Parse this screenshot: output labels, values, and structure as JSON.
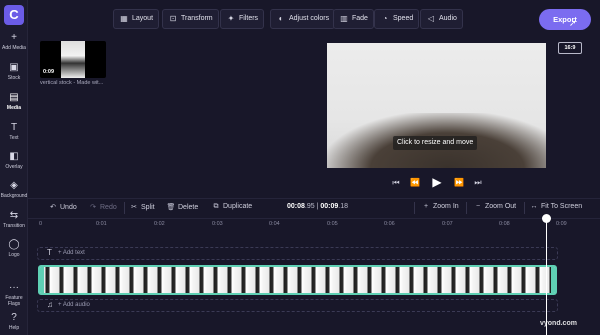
{
  "app": {
    "logo_letter": "C"
  },
  "sidebar": {
    "items": [
      {
        "label": "Add Media",
        "icon": "+"
      },
      {
        "label": "Stock",
        "icon": "▣"
      },
      {
        "label": "Media",
        "icon": "▤"
      },
      {
        "label": "Text",
        "icon": "T"
      },
      {
        "label": "Overlay",
        "icon": "◧"
      },
      {
        "label": "Background",
        "icon": "◈"
      },
      {
        "label": "Transition",
        "icon": "⇆"
      },
      {
        "label": "Logo",
        "icon": "◯"
      },
      {
        "label": "Feature Flags",
        "icon": "···"
      },
      {
        "label": "Help",
        "icon": "?"
      }
    ]
  },
  "toolbar": {
    "buttons": [
      {
        "label": "Layout",
        "icon": "▦"
      },
      {
        "label": "Transform",
        "icon": "⊡"
      },
      {
        "label": "Filters",
        "icon": "✦"
      },
      {
        "label": "Adjust colors",
        "icon": "◐"
      },
      {
        "label": "Fade",
        "icon": "▥"
      },
      {
        "label": "Speed",
        "icon": "◔"
      },
      {
        "label": "Audio",
        "icon": "◁"
      }
    ],
    "export_label": "Export"
  },
  "media": {
    "thumb_time": "0:09",
    "caption": "vertical stock - Made wit..."
  },
  "preview": {
    "label": "Click to resize and move",
    "aspect_ratio": "16:9"
  },
  "playback": {
    "controls": [
      "skip-start-icon",
      "rewind-icon",
      "play-icon",
      "forward-icon",
      "skip-end-icon"
    ]
  },
  "timeline_controls": {
    "undo": "Undo",
    "redo": "Redo",
    "split": "Split",
    "delete": "Delete",
    "duplicate": "Duplicate",
    "time_current": "00:08",
    "time_current_frac": ".95",
    "time_separator": " | ",
    "time_total": "00:09",
    "time_total_frac": ".18",
    "zoom_in": "Zoom In",
    "zoom_out": "Zoom Out",
    "fit": "Fit To Screen"
  },
  "ruler": {
    "ticks": [
      "0",
      "0:01",
      "0:02",
      "0:03",
      "0:04",
      "0:05",
      "0:06",
      "0:07",
      "0:08",
      "0:09"
    ]
  },
  "tracks": {
    "text_label": "+ Add text",
    "audio_label": "+ Add audio"
  },
  "watermark": "vyond.com"
}
